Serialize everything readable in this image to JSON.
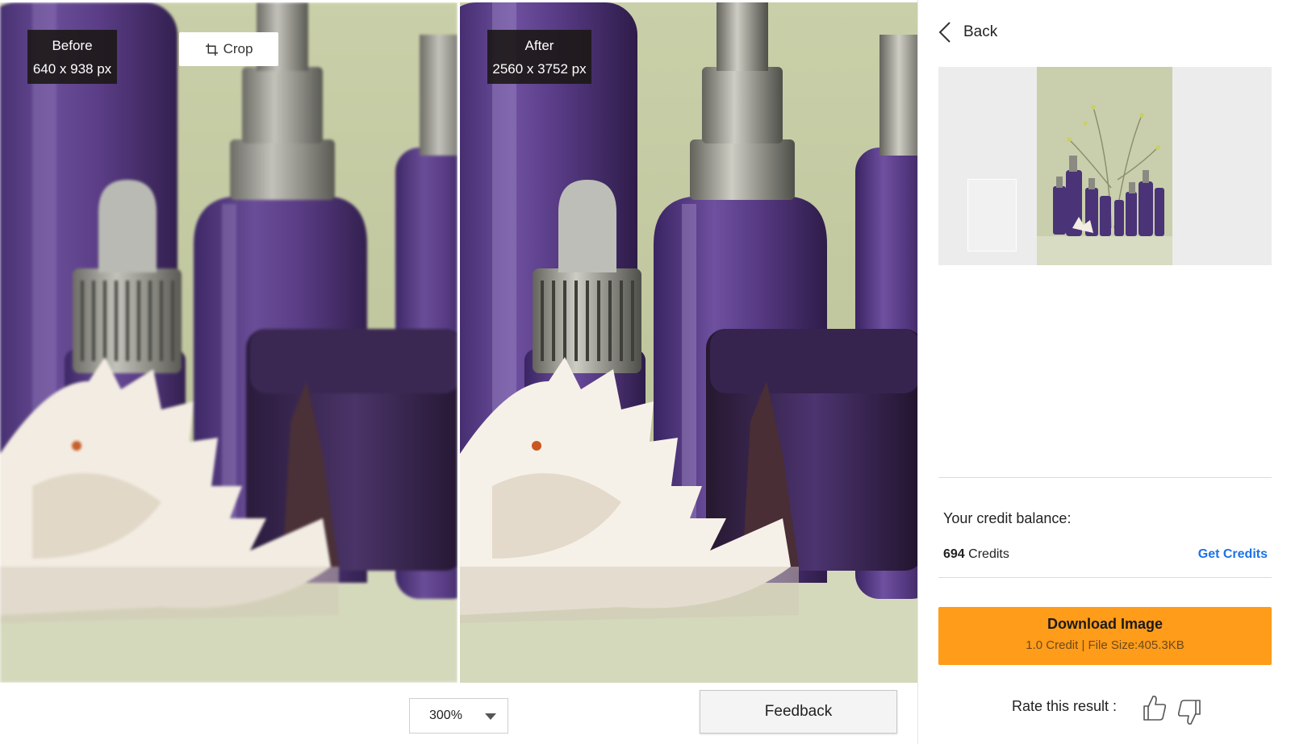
{
  "compare": {
    "before": {
      "label": "Before",
      "size": "640 x 938 px"
    },
    "after": {
      "label": "After",
      "size": "2560 x 3752 px"
    },
    "crop_label": "Crop"
  },
  "toolbar": {
    "zoom": "300%",
    "feedback_label": "Feedback"
  },
  "side": {
    "back_label": "Back",
    "credit_label": "Your credit balance:",
    "credits_value": "694",
    "credits_unit": "Credits",
    "get_credits_label": "Get Credits",
    "download": {
      "title": "Download Image",
      "meta": "1.0 Credit | File Size:405.3KB"
    },
    "rate_label": "Rate this result :"
  },
  "colors": {
    "accent_orange": "#ff9c1a",
    "link_blue": "#1a73e8",
    "background_sage": "#c6cba6",
    "bottle_purple": "#5a3d86"
  },
  "icons": [
    "crop-icon",
    "chevron-left-icon",
    "caret-down-icon",
    "thumbs-up-icon",
    "thumbs-down-icon"
  ]
}
